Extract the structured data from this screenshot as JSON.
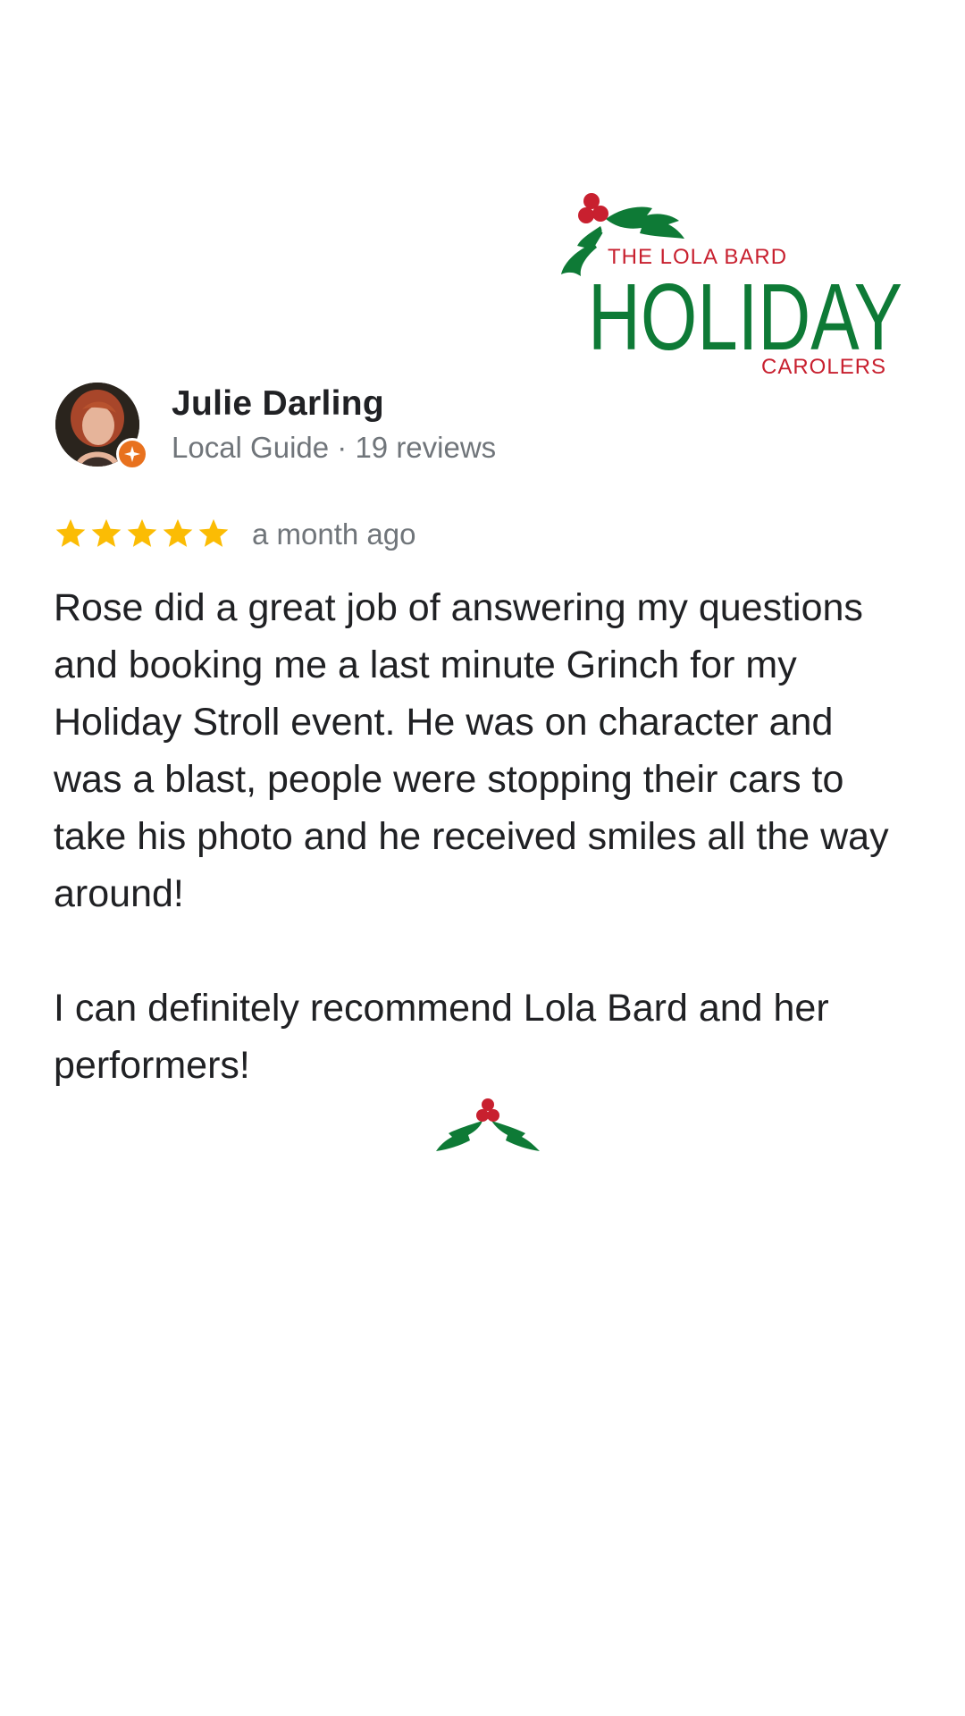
{
  "logo": {
    "line1": "THE LOLA BARD",
    "line2": "HOLIDAY",
    "line3": "CAROLERS",
    "colors": {
      "red": "#c8202f",
      "green": "#0e7a36"
    }
  },
  "reviewer": {
    "name": "Julie Darling",
    "meta": "Local Guide · 19 reviews",
    "badge_icon": "local-guide-star-icon"
  },
  "review": {
    "rating": 5,
    "rating_max": 5,
    "time": "a month ago",
    "paragraph1": "Rose did a great job of answering my questions and booking me a last minute Grinch for my Holiday Stroll event. He was on character and was a blast, people were stopping their cars to take his photo and he received smiles all the way around!",
    "paragraph2": "I can definitely recommend Lola Bard and her performers!"
  },
  "colors": {
    "star": "#fbbc04",
    "secondary_text": "#70757a",
    "primary_text": "#202124",
    "badge": "#e8711e"
  }
}
